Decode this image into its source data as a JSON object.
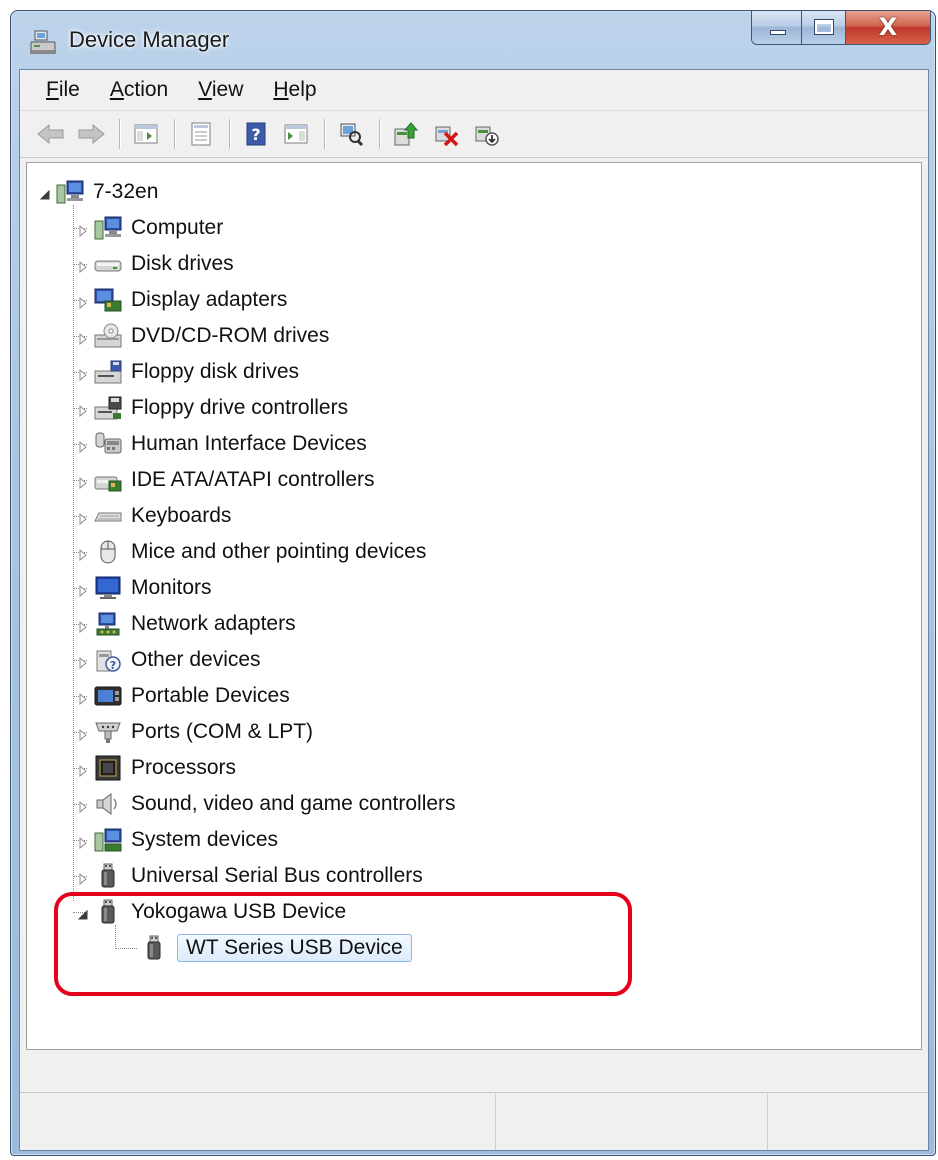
{
  "window": {
    "title": "Device Manager"
  },
  "menu": [
    {
      "key": "F",
      "rest": "ile"
    },
    {
      "key": "A",
      "rest": "ction"
    },
    {
      "key": "V",
      "rest": "iew"
    },
    {
      "key": "H",
      "rest": "elp"
    }
  ],
  "toolbar": [
    {
      "name": "back-icon"
    },
    {
      "name": "forward-icon"
    },
    {
      "name": "show-hide-console-tree-icon"
    },
    {
      "name": "properties-icon"
    },
    {
      "name": "help-icon"
    },
    {
      "name": "action-pane-icon"
    },
    {
      "name": "scan-hardware-icon"
    },
    {
      "name": "update-driver-icon"
    },
    {
      "name": "uninstall-icon"
    },
    {
      "name": "disable-device-icon"
    }
  ],
  "tree": {
    "root": {
      "label": "7-32en",
      "icon": "computer-icon",
      "expanded": true
    },
    "categories": [
      {
        "label": "Computer",
        "icon": "computer-icon"
      },
      {
        "label": "Disk drives",
        "icon": "disk-drive-icon"
      },
      {
        "label": "Display adapters",
        "icon": "display-adapter-icon"
      },
      {
        "label": "DVD/CD-ROM drives",
        "icon": "dvd-drive-icon"
      },
      {
        "label": "Floppy disk drives",
        "icon": "floppy-drive-icon"
      },
      {
        "label": "Floppy drive controllers",
        "icon": "floppy-controller-icon"
      },
      {
        "label": "Human Interface Devices",
        "icon": "hid-icon"
      },
      {
        "label": "IDE ATA/ATAPI controllers",
        "icon": "ide-controller-icon"
      },
      {
        "label": "Keyboards",
        "icon": "keyboard-icon"
      },
      {
        "label": "Mice and other pointing devices",
        "icon": "mouse-icon"
      },
      {
        "label": "Monitors",
        "icon": "monitor-icon"
      },
      {
        "label": "Network adapters",
        "icon": "network-adapter-icon"
      },
      {
        "label": "Other devices",
        "icon": "unknown-device-icon"
      },
      {
        "label": "Portable Devices",
        "icon": "portable-device-icon"
      },
      {
        "label": "Ports (COM & LPT)",
        "icon": "port-icon"
      },
      {
        "label": "Processors",
        "icon": "processor-icon"
      },
      {
        "label": "Sound, video and game controllers",
        "icon": "sound-icon"
      },
      {
        "label": "System devices",
        "icon": "system-device-icon"
      },
      {
        "label": "Universal Serial Bus controllers",
        "icon": "usb-icon"
      },
      {
        "label": "Yokogawa USB Device",
        "icon": "usb-icon",
        "expanded": true
      }
    ],
    "child": {
      "label": "WT Series USB Device",
      "icon": "usb-icon",
      "selected": true
    }
  },
  "colors": {
    "highlight": "#e3001b",
    "selection_border": "#8fb7e6"
  }
}
